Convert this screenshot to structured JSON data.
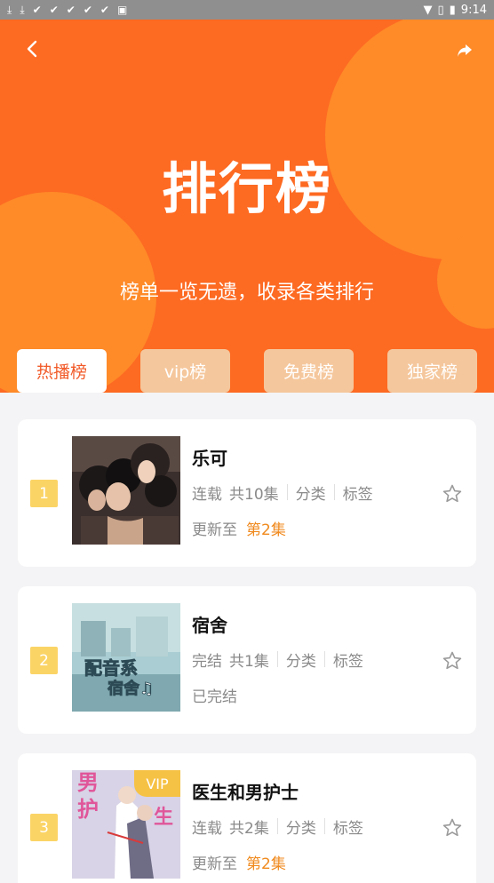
{
  "status_bar": {
    "time": "9:14",
    "notification_icons": [
      "download-icon",
      "download-icon",
      "check-icon",
      "check-icon",
      "check-icon",
      "check-icon",
      "check-icon",
      "app-icon"
    ]
  },
  "header": {
    "title": "排行榜",
    "subtitle": "榜单一览无遗，收录各类排行",
    "back_icon": "chevron-left-icon",
    "share_icon": "share-icon"
  },
  "tabs": [
    {
      "label": "热播榜",
      "active": true
    },
    {
      "label": "vip榜",
      "active": false
    },
    {
      "label": "免费榜",
      "active": false
    },
    {
      "label": "独家榜",
      "active": false
    }
  ],
  "items": [
    {
      "rank": "1",
      "title": "乐可",
      "status": "连载",
      "episodes": "共10集",
      "category": "分类",
      "tag": "标签",
      "update_prefix": "更新至",
      "update_episode": "第2集",
      "vip": ""
    },
    {
      "rank": "2",
      "title": "宿舍",
      "status": "完结",
      "episodes": "共1集",
      "category": "分类",
      "tag": "标签",
      "update_prefix": "已完结",
      "update_episode": "",
      "vip": "",
      "cover_text_1": "配音系",
      "cover_text_2": "宿舍♫"
    },
    {
      "rank": "3",
      "title": "医生和男护士",
      "status": "连载",
      "episodes": "共2集",
      "category": "分类",
      "tag": "标签",
      "update_prefix": "更新至",
      "update_episode": "第2集",
      "vip": "VIP",
      "cover_text_1": "男",
      "cover_text_2": "护",
      "cover_text_3": "生"
    }
  ],
  "colors": {
    "hero_bg": "#fd6a22",
    "hero_blob": "#fe8a28",
    "active_tab_text": "#f25b2a",
    "inactive_tab_bg": "#f5c79c",
    "rank_badge": "#fbd466",
    "episode_highlight": "#f08a1e"
  }
}
